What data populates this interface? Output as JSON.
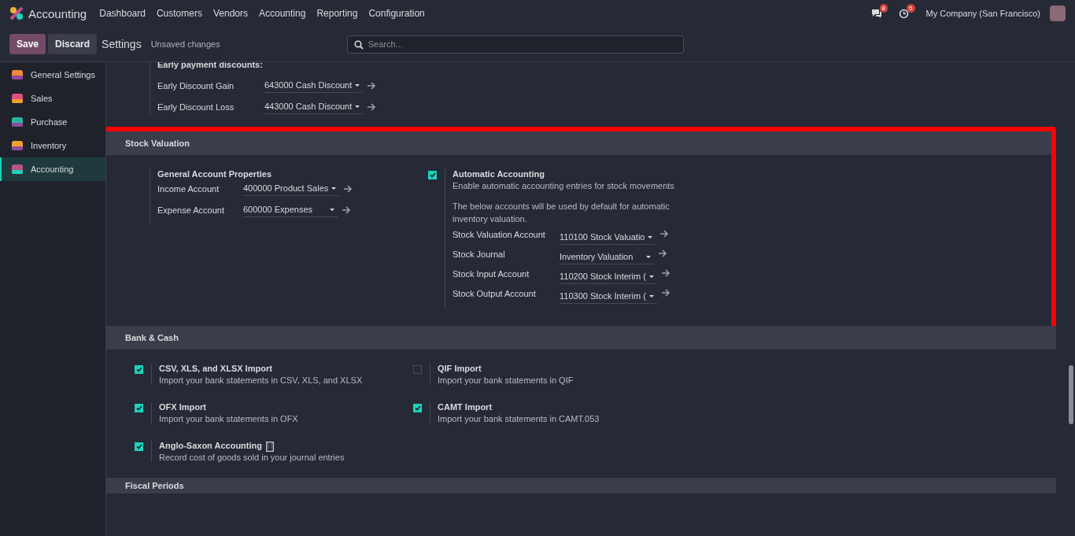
{
  "topbar": {
    "app": "Accounting",
    "menu": [
      "Dashboard",
      "Customers",
      "Vendors",
      "Accounting",
      "Reporting",
      "Configuration"
    ],
    "messages_count": "8",
    "activities_count": "5",
    "company": "My Company (San Francisco)"
  },
  "control_panel": {
    "buttons": [
      {
        "label": "Save",
        "kind": "primary"
      },
      {
        "label": "Discard",
        "kind": "secondary"
      }
    ],
    "title": "Settings",
    "status": "Unsaved changes",
    "search": {
      "placeholder": "Search..."
    }
  },
  "sidebar": {
    "items": [
      {
        "label": "General Settings",
        "selected": false
      },
      {
        "label": "Sales",
        "selected": false
      },
      {
        "label": "Purchase",
        "selected": false
      },
      {
        "label": "Inventory",
        "selected": false
      },
      {
        "label": "Accounting",
        "selected": true
      }
    ]
  },
  "early_discounts": {
    "heading": "Early payment discounts:",
    "fields": [
      {
        "label": "Early Discount Gain",
        "value": "643000 Cash Discount"
      },
      {
        "label": "Early Discount Loss",
        "value": "443000 Cash Discount"
      }
    ]
  },
  "stock_valuation": {
    "title": "Stock Valuation",
    "highlighted": true,
    "general": {
      "heading": "General Account Properties",
      "fields": [
        {
          "label": "Income Account",
          "value": "400000 Product Sales"
        },
        {
          "label": "Expense Account",
          "value": "600000 Expenses"
        }
      ]
    },
    "automatic": {
      "checked": true,
      "title": "Automatic Accounting",
      "description": "Enable automatic accounting entries for stock movements",
      "note": "The below accounts will be used by default for automatic inventory valuation.",
      "fields": [
        {
          "label": "Stock Valuation Account",
          "value": "110100 Stock Valuatio"
        },
        {
          "label": "Stock Journal",
          "value": "Inventory Valuation"
        },
        {
          "label": "Stock Input Account",
          "value": "110200 Stock Interim ("
        },
        {
          "label": "Stock Output Account",
          "value": "110300 Stock Interim ("
        }
      ]
    }
  },
  "bank_cash": {
    "title": "Bank & Cash",
    "highlighted": false,
    "options": [
      {
        "title": "CSV, XLS, and XLSX Import",
        "description": "Import your bank statements in CSV, XLS, and XLSX",
        "checked": true,
        "company_icon": false
      },
      {
        "title": "QIF Import",
        "description": "Import your bank statements in QIF",
        "checked": false,
        "company_icon": false
      },
      {
        "title": "OFX Import",
        "description": "Import your bank statements in OFX",
        "checked": true,
        "company_icon": false
      },
      {
        "title": "CAMT Import",
        "description": "Import your bank statements in CAMT.053",
        "checked": true,
        "company_icon": false
      },
      {
        "title": "Anglo-Saxon Accounting",
        "description": "Record cost of goods sold in your journal entries",
        "checked": true,
        "company_icon": true
      }
    ]
  },
  "next_section": {
    "title": "Fiscal Periods"
  }
}
